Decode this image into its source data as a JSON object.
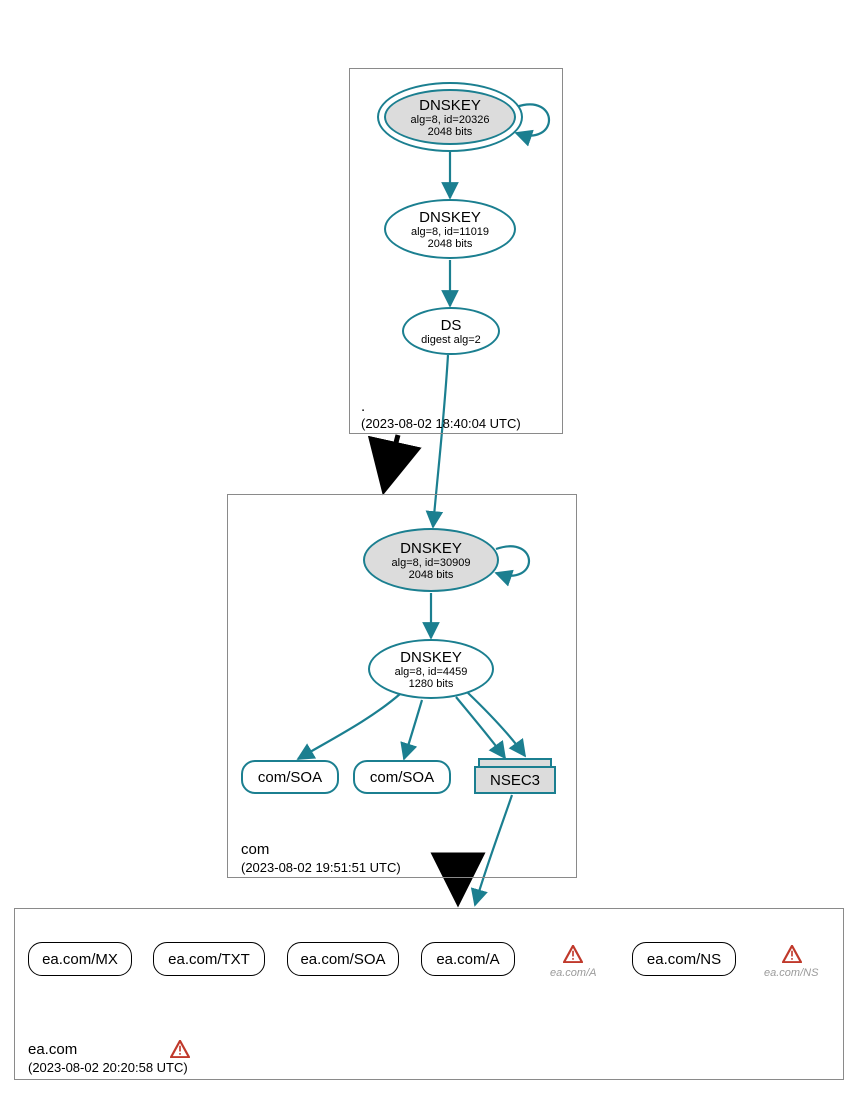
{
  "zones": {
    "root": {
      "label": ".",
      "timestamp": "(2023-08-02 18:40:04 UTC)",
      "ksk": {
        "type": "DNSKEY",
        "alg": "alg=8, id=20326",
        "bits": "2048 bits"
      },
      "zsk": {
        "type": "DNSKEY",
        "alg": "alg=8, id=11019",
        "bits": "2048 bits"
      },
      "ds": {
        "type": "DS",
        "digest": "digest alg=2"
      }
    },
    "com": {
      "label": "com",
      "timestamp": "(2023-08-02 19:51:51 UTC)",
      "ksk": {
        "type": "DNSKEY",
        "alg": "alg=8, id=30909",
        "bits": "2048 bits"
      },
      "zsk": {
        "type": "DNSKEY",
        "alg": "alg=8, id=4459",
        "bits": "1280 bits"
      },
      "soa1": "com/SOA",
      "soa2": "com/SOA",
      "nsec3": "NSEC3"
    },
    "eacom": {
      "label": "ea.com",
      "timestamp": "(2023-08-02 20:20:58 UTC)",
      "records": [
        "ea.com/MX",
        "ea.com/TXT",
        "ea.com/SOA",
        "ea.com/A",
        "ea.com/NS"
      ],
      "warnings": [
        {
          "label": "ea.com/A"
        },
        {
          "label": "ea.com/NS"
        },
        {
          "label": ""
        }
      ]
    }
  }
}
